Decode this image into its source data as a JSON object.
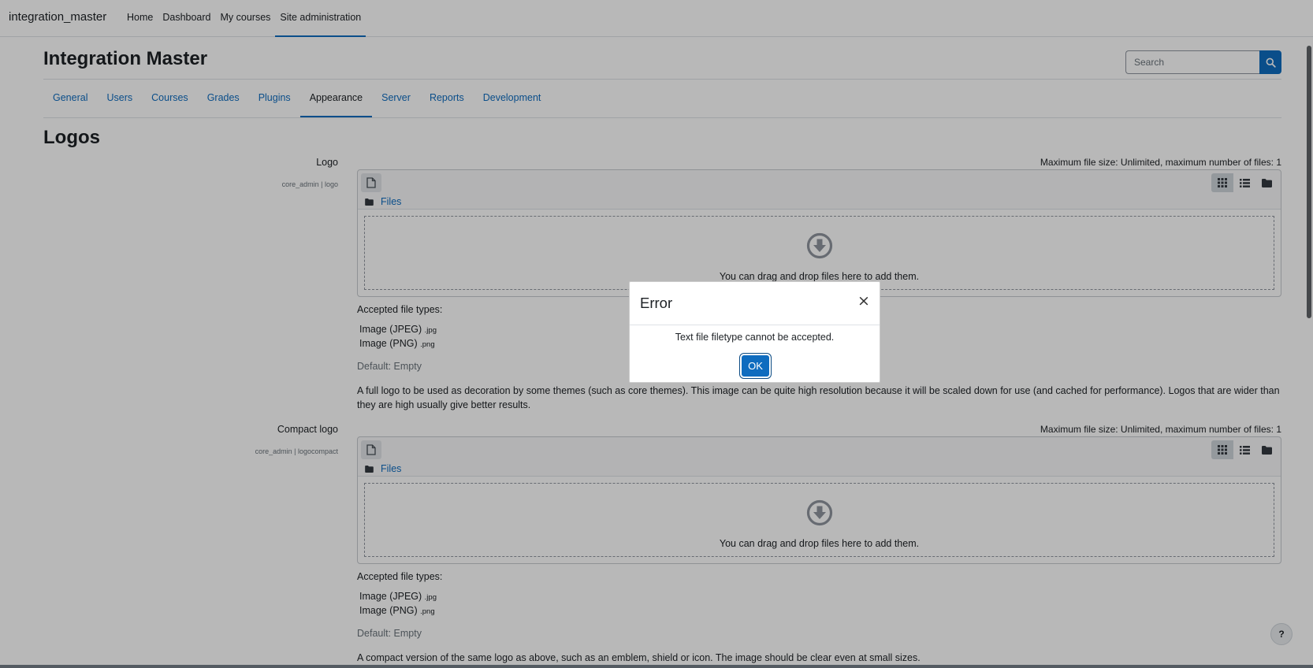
{
  "navbar": {
    "brand": "integration_master",
    "items": [
      {
        "label": "Home"
      },
      {
        "label": "Dashboard"
      },
      {
        "label": "My courses"
      },
      {
        "label": "Site administration"
      }
    ]
  },
  "header": {
    "title": "Integration Master",
    "search_placeholder": "Search"
  },
  "tabs": [
    {
      "label": "General"
    },
    {
      "label": "Users"
    },
    {
      "label": "Courses"
    },
    {
      "label": "Grades"
    },
    {
      "label": "Plugins"
    },
    {
      "label": "Appearance"
    },
    {
      "label": "Server"
    },
    {
      "label": "Reports"
    },
    {
      "label": "Development"
    }
  ],
  "section": {
    "heading": "Logos"
  },
  "settings": [
    {
      "label": "Logo",
      "key": "core_admin | logo",
      "max_files": "Maximum file size: Unlimited, maximum number of files: 1",
      "files_link": "Files",
      "drop_text": "You can drag and drop files here to add them.",
      "accepted_label": "Accepted file types:",
      "types": [
        {
          "name": "Image (JPEG)",
          "ext": ".jpg"
        },
        {
          "name": "Image (PNG)",
          "ext": ".png"
        }
      ],
      "default": "Default: Empty",
      "description": "A full logo to be used as decoration by some themes (such as core themes). This image can be quite high resolution because it will be scaled down for use (and cached for performance). Logos that are wider than they are high usually give better results."
    },
    {
      "label": "Compact logo",
      "key": "core_admin | logocompact",
      "max_files": "Maximum file size: Unlimited, maximum number of files: 1",
      "files_link": "Files",
      "drop_text": "You can drag and drop files here to add them.",
      "accepted_label": "Accepted file types:",
      "types": [
        {
          "name": "Image (JPEG)",
          "ext": ".jpg"
        },
        {
          "name": "Image (PNG)",
          "ext": ".png"
        }
      ],
      "default": "Default: Empty",
      "description": "A compact version of the same logo as above, such as an emblem, shield or icon. The image should be clear even at small sizes."
    }
  ],
  "modal": {
    "title": "Error",
    "close_symbol": "×",
    "message": "Text file filetype cannot be accepted.",
    "ok_label": "OK"
  },
  "help": {
    "label": "?"
  },
  "colors": {
    "accent": "#0f6cbf",
    "backdrop": "rgba(0,0,0,0.28)"
  }
}
